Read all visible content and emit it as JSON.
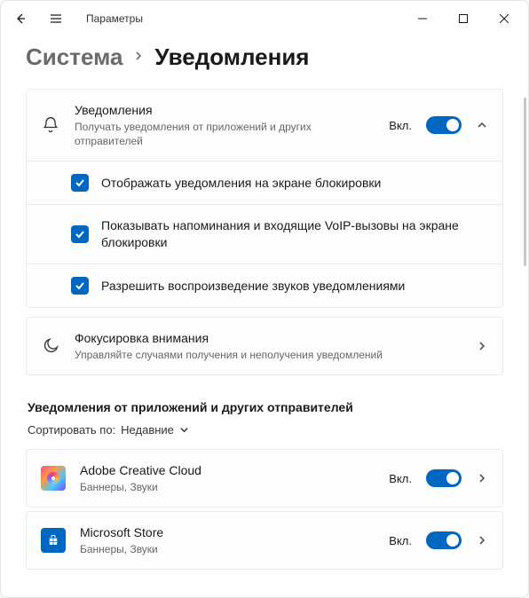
{
  "titlebar": {
    "app_title": "Параметры"
  },
  "breadcrumb": {
    "parent": "Система",
    "current": "Уведомления"
  },
  "notifications": {
    "title": "Уведомления",
    "desc": "Получать уведомления от приложений и других отправителей",
    "toggle_label": "Вкл.",
    "options": [
      "Отображать уведомления на экране блокировки",
      "Показывать напоминания и входящие VoIP-вызовы на экране блокировки",
      "Разрешить  воспроизведение звуков уведомлениями"
    ]
  },
  "focus": {
    "title": "Фокусировка внимания",
    "desc": "Управляйте случаями получения и неполучения уведомлений"
  },
  "apps_section": {
    "heading": "Уведомления от приложений и других отправителей",
    "sort_label": "Сортировать по:",
    "sort_value": "Недавние"
  },
  "apps": [
    {
      "name": "Adobe Creative Cloud",
      "desc": "Баннеры, Звуки",
      "toggle_label": "Вкл."
    },
    {
      "name": "Microsoft Store",
      "desc": "Баннеры, Звуки",
      "toggle_label": "Вкл."
    }
  ]
}
